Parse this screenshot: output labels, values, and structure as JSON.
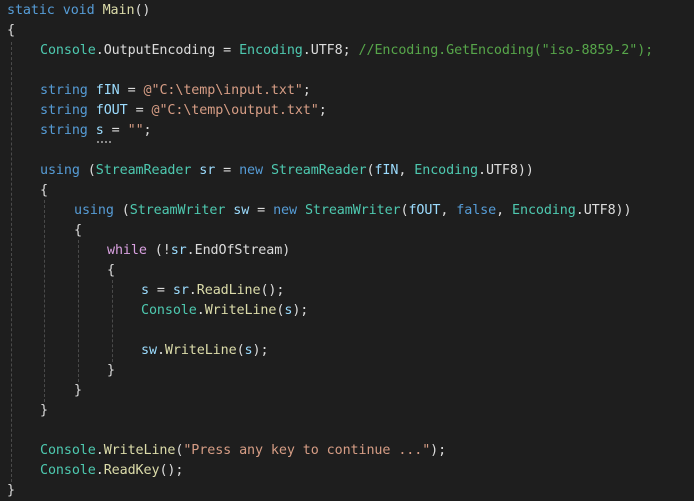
{
  "editor": {
    "language": "C#",
    "lines": [
      {
        "tokens": [
          "static",
          "void",
          "Main",
          "()"
        ]
      },
      {
        "tokens": [
          "{"
        ]
      },
      {
        "tokens": [
          "Console",
          ".",
          "OutputEncoding",
          " = ",
          "Encoding",
          ".",
          "UTF8",
          "; ",
          "//Encoding.GetEncoding(\"iso-8859-2\");"
        ]
      },
      {
        "tokens": []
      },
      {
        "tokens": [
          "string",
          "fIN",
          " = ",
          "@\"C:\\temp\\input.txt\"",
          ";"
        ]
      },
      {
        "tokens": [
          "string",
          "fOUT",
          " = ",
          "@\"C:\\temp\\output.txt\"",
          ";"
        ]
      },
      {
        "tokens": [
          "string",
          "s",
          " = ",
          "\"\"",
          ";"
        ]
      },
      {
        "tokens": []
      },
      {
        "tokens": [
          "using",
          " (",
          "StreamReader",
          " ",
          "sr",
          " = ",
          "new",
          " ",
          "StreamReader",
          "(",
          "fIN",
          ", ",
          "Encoding",
          ".",
          "UTF8",
          "))"
        ]
      },
      {
        "tokens": [
          "{"
        ]
      },
      {
        "tokens": [
          "using",
          " (",
          "StreamWriter",
          " ",
          "sw",
          " = ",
          "new",
          " ",
          "StreamWriter",
          "(",
          "fOUT",
          ", ",
          "false",
          ", ",
          "Encoding",
          ".",
          "UTF8",
          "))"
        ]
      },
      {
        "tokens": [
          "{"
        ]
      },
      {
        "tokens": [
          "while",
          " (!",
          "sr",
          ".",
          "EndOfStream",
          ")"
        ]
      },
      {
        "tokens": [
          "{"
        ]
      },
      {
        "tokens": [
          "s",
          " = ",
          "sr",
          ".",
          "ReadLine",
          "();"
        ]
      },
      {
        "tokens": [
          "Console",
          ".",
          "WriteLine",
          "(",
          "s",
          ");"
        ]
      },
      {
        "tokens": []
      },
      {
        "tokens": [
          "sw",
          ".",
          "WriteLine",
          "(",
          "s",
          ");"
        ]
      },
      {
        "tokens": [
          "}"
        ]
      },
      {
        "tokens": [
          "}"
        ]
      },
      {
        "tokens": [
          "}"
        ]
      },
      {
        "tokens": []
      },
      {
        "tokens": [
          "Console",
          ".",
          "WriteLine",
          "(",
          "\"Press any key to continue ...\"",
          ");"
        ]
      },
      {
        "tokens": [
          "Console",
          ".",
          "ReadKey",
          "();"
        ]
      },
      {
        "tokens": [
          "}"
        ]
      }
    ]
  },
  "colors": {
    "background": "#1e1e1e",
    "keyword": "#569cd6",
    "control_keyword": "#d8a0df",
    "type": "#4ec9b0",
    "method": "#dcdcaa",
    "variable": "#9cdcfe",
    "string": "#d69d85",
    "comment": "#57a64a",
    "punctuation": "#dcdcdc"
  }
}
